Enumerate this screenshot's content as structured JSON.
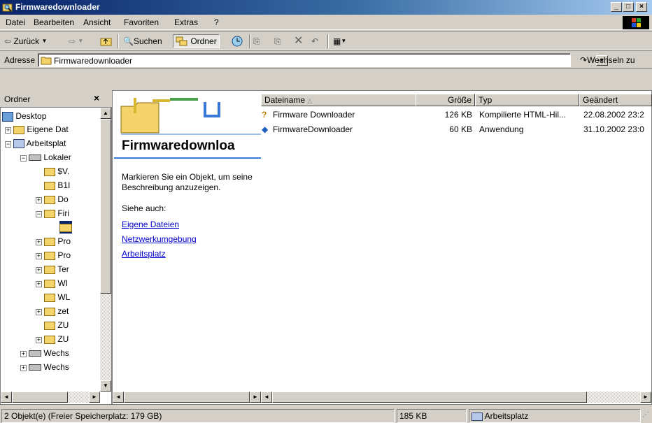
{
  "window": {
    "title": "Firmwaredownloader"
  },
  "menu": [
    "Datei",
    "Bearbeiten",
    "Ansicht",
    "Favoriten",
    "Extras",
    "?"
  ],
  "toolbar": {
    "back": "Zurück",
    "search": "Suchen",
    "folders": "Ordner"
  },
  "address": {
    "label": "Adresse",
    "value": "Firmwaredownloader",
    "go": "Wechseln zu"
  },
  "folderpane": {
    "title": "Ordner",
    "items": [
      "Desktop",
      "Eigene Dat",
      "Arbeitsplat",
      "Lokaler",
      "$V.",
      "B1I",
      "Do",
      "Firi",
      "",
      "Pro",
      "Pro",
      "Ter",
      "WI",
      "WL",
      "zet",
      "ZU",
      "ZU",
      "Wechs",
      "Wechs"
    ]
  },
  "webview": {
    "heading": "Firmwaredownloa",
    "description": "Markieren Sie ein Objekt, um seine Beschreibung anzuzeigen.",
    "see_also": "Siehe auch:",
    "links": [
      "Eigene Dateien",
      "Netzwerkumgebung",
      "Arbeitsplatz"
    ]
  },
  "columns": {
    "name": "Dateiname",
    "size": "Größe",
    "type": "Typ",
    "modified": "Geändert"
  },
  "files": [
    {
      "name": "Firmware Downloader",
      "size": "126 KB",
      "type": "Kompilierte HTML-Hil...",
      "modified": "22.08.2002 23:2"
    },
    {
      "name": "FirmwareDownloader",
      "size": "60 KB",
      "type": "Anwendung",
      "modified": "31.10.2002 23:0"
    }
  ],
  "status": {
    "objects": "2 Objekt(e)  (Freier Speicherplatz: 179 GB)",
    "size": "185 KB",
    "location": "Arbeitsplatz"
  }
}
